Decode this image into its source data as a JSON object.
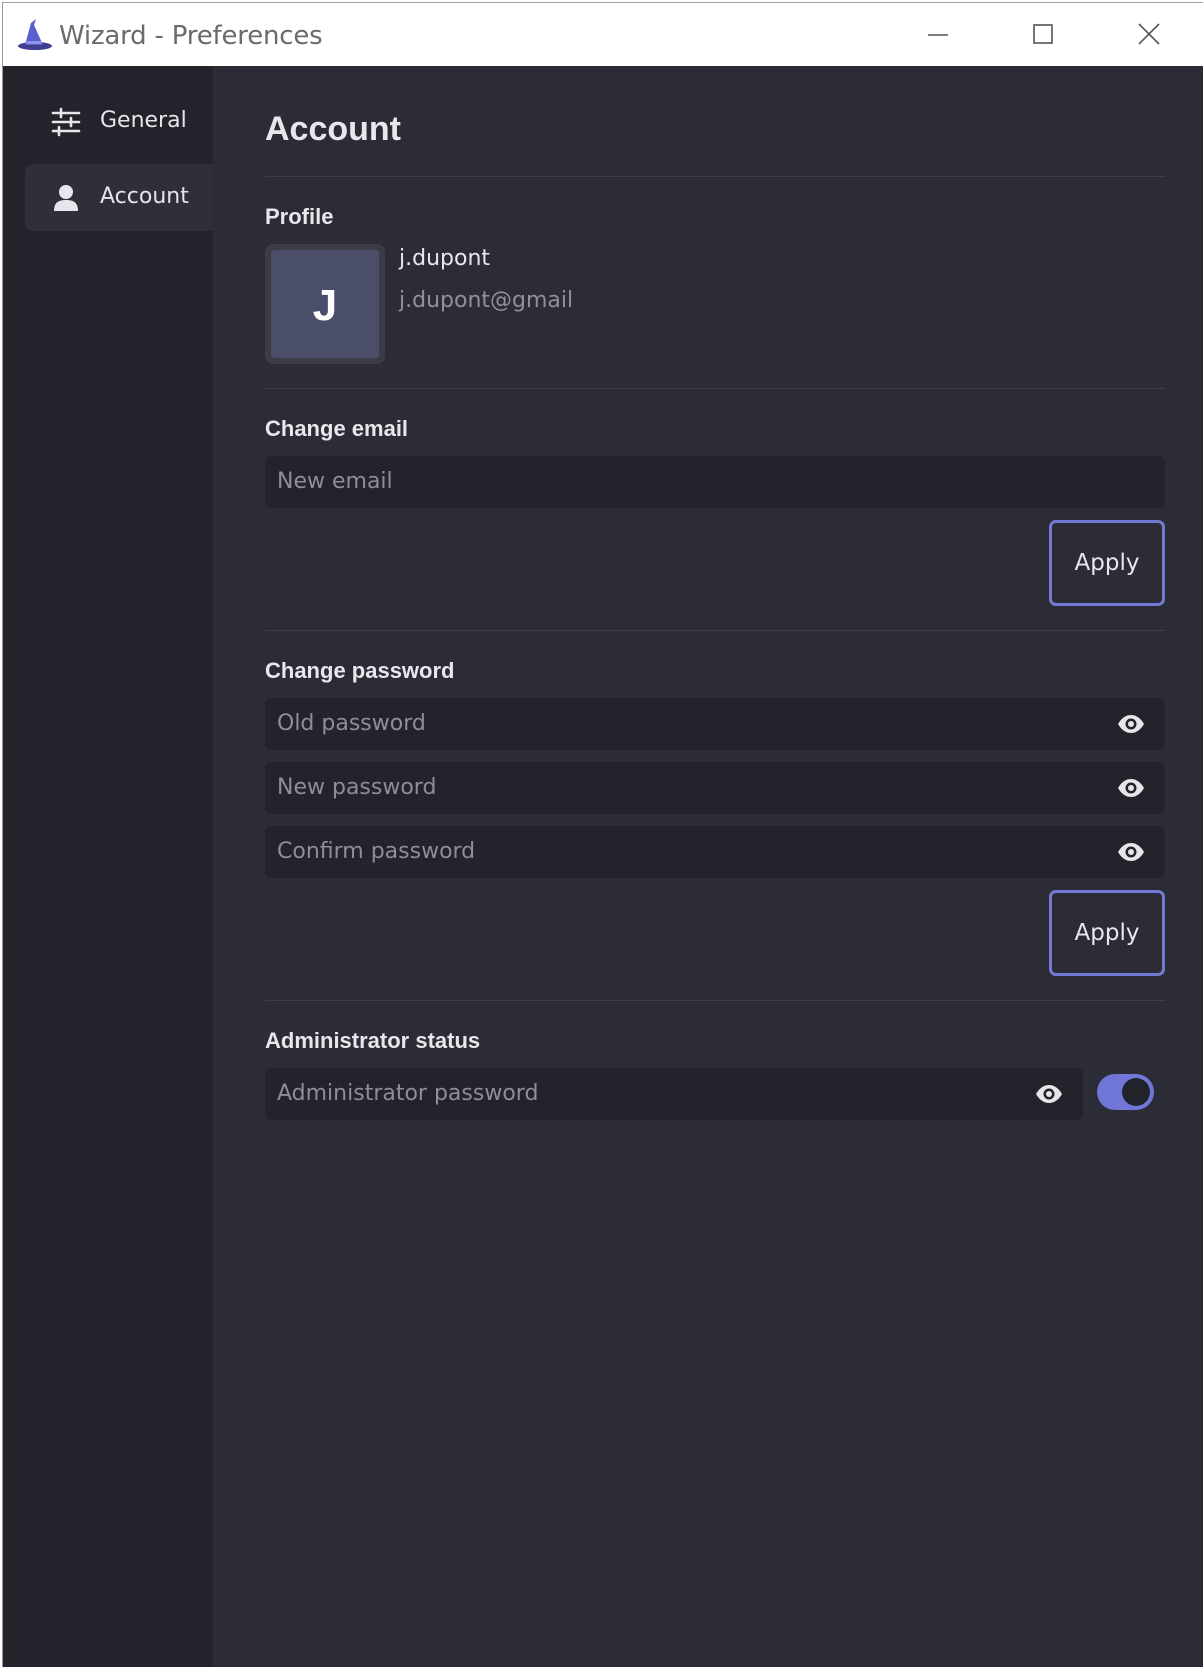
{
  "window": {
    "title": "Wizard - Preferences"
  },
  "sidebar": {
    "items": [
      {
        "label": "General",
        "icon": "sliders-icon"
      },
      {
        "label": "Account",
        "icon": "user-icon",
        "active": true
      }
    ]
  },
  "page": {
    "title": "Account"
  },
  "profile": {
    "section_title": "Profile",
    "avatar_initial": "J",
    "username": "j.dupont",
    "email": "j.dupont@gmail"
  },
  "change_email": {
    "section_title": "Change email",
    "input_placeholder": "New email",
    "apply_label": "Apply"
  },
  "change_password": {
    "section_title": "Change password",
    "old_placeholder": "Old password",
    "new_placeholder": "New password",
    "confirm_placeholder": "Confirm password",
    "apply_label": "Apply"
  },
  "admin": {
    "section_title": "Administrator status",
    "password_placeholder": "Administrator password",
    "toggle_on": true
  },
  "colors": {
    "accent": "#7479d4",
    "background": "#2b2c35",
    "sidebar": "#22232b"
  }
}
